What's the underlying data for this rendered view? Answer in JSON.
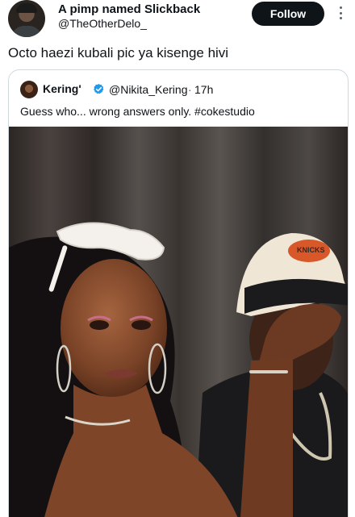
{
  "author": {
    "display_name": "A pimp named Slickback",
    "handle": "@TheOtherDelo_",
    "avatar": "user-avatar",
    "follow_label": "Follow",
    "more_icon": "more-options-icon"
  },
  "tweet": {
    "text": "Octo haezi kubali pic ya kisenge hivi"
  },
  "quoted": {
    "display_name": "Kering'",
    "verified_icon": "verified-badge-icon",
    "handle": "@Nikita_Kering",
    "separator": "·",
    "time": "17h",
    "text": "Guess who... wrong answers only. #cokestudio",
    "media": "photo-woman-with-sunglasses-and-man-in-knicks-cap",
    "cap_text": "KNICKS"
  },
  "colors": {
    "text": "#0f1419",
    "muted": "#536471",
    "border": "#cfd9de",
    "follow_bg": "#0f1419",
    "verified": "#1d9bf0"
  }
}
